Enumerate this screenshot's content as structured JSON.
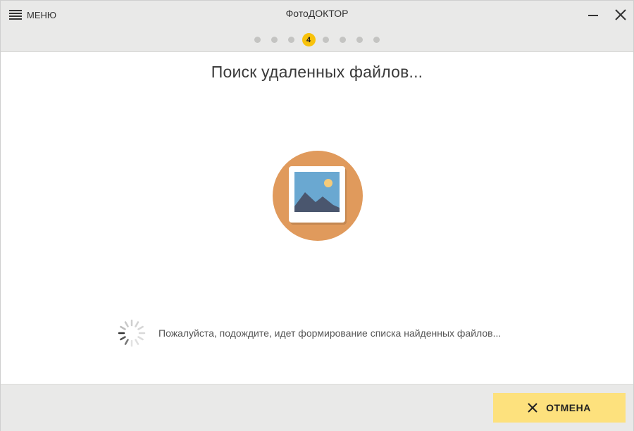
{
  "header": {
    "menu_label": "МЕНЮ",
    "title": "ФотоДОКТОР",
    "menu_icon": "hamburger-icon",
    "minimize_icon": "minimize-icon",
    "close_icon": "close-icon"
  },
  "steps": {
    "total": 8,
    "current": 4,
    "current_label": "4",
    "active_color": "#f8c20b",
    "inactive_color": "#c4c4c2"
  },
  "main": {
    "title": "Поиск удаленных файлов...",
    "illustration_icon": "photo-icon",
    "illustration_circle_color": "#e09a5c",
    "status_text": "Пожалуйста, подождите, идет формирование списка найденных файлов...",
    "spinner_icon": "loading-spinner-icon"
  },
  "footer": {
    "cancel_label": "ОТМЕНА",
    "cancel_icon": "close-icon",
    "cancel_color": "#fde17d"
  }
}
